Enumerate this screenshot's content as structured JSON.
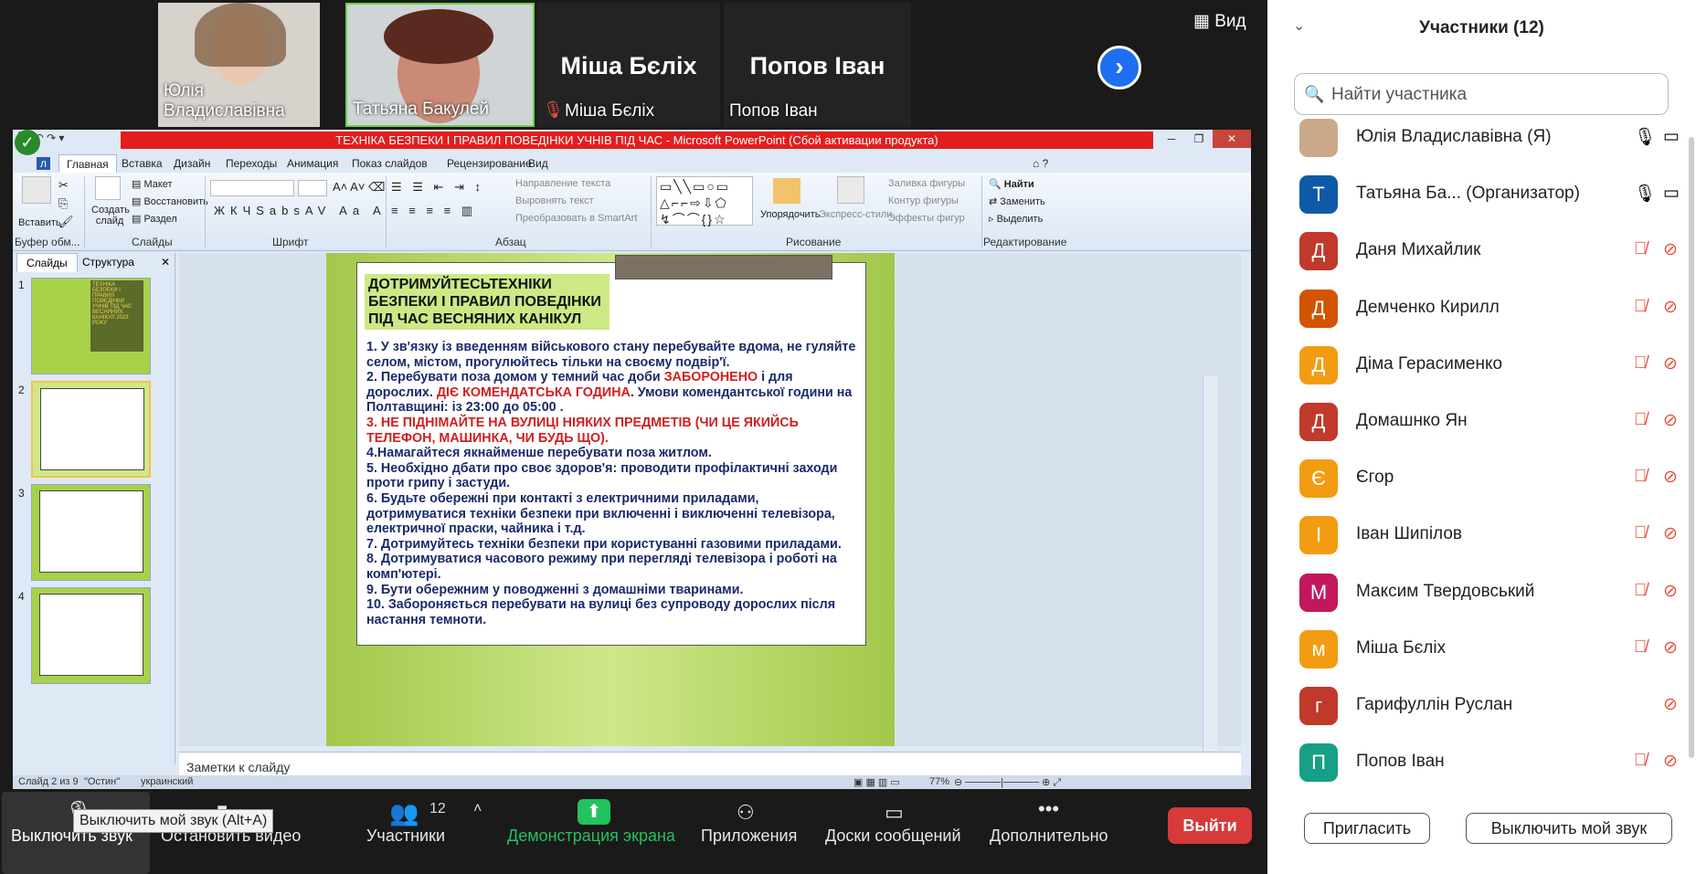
{
  "strip": {
    "tiles": [
      {
        "name": "Юлія Владиславівна"
      },
      {
        "name": "Татьяна Бакулей"
      },
      {
        "name": "Міша Бєліх",
        "big": "Міша Бєліх"
      },
      {
        "name": "Попов Іван",
        "big": "Попов Іван"
      }
    ],
    "view_label": "Вид"
  },
  "ppt": {
    "title": "ТЕХНІКА БЕЗПЕКИ І ПРАВИЛ ПОВЕДІНКИ УЧНІВ ПІД ЧАС  - Microsoft PowerPoint (Сбой активации продукта)",
    "file_tab": "л",
    "tabs": [
      "Главная",
      "Вставка",
      "Дизайн",
      "Переходы",
      "Анимация",
      "Показ слайдов",
      "Рецензирование",
      "Вид"
    ],
    "ribbon": {
      "paste": "Вставить",
      "clipboard_group": "Буфер обм...",
      "create_slide": "Создать слайд",
      "layout": "Макет",
      "restore": "Восстановить",
      "section": "Раздел",
      "slides_group": "Слайды",
      "font_group": "Шрифт",
      "paragraph_group": "Абзац",
      "text_direction": "Направление текста",
      "align_text": "Выровнять текст",
      "smartart": "Преобразовать в SmartArt",
      "arrange": "Упорядочить",
      "quick_styles": "Экспресс-стили",
      "shape_fill": "Заливка фигуры",
      "shape_outline": "Контур фигуры",
      "shape_effects": "Эффекты фигур",
      "drawing_group": "Рисование",
      "find": "Найти",
      "replace": "Заменить",
      "select": "Выделить",
      "editing_group": "Редактирование"
    },
    "left_tabs": {
      "slides": "Слайды",
      "outline": "Структура"
    },
    "slide_numbers": [
      "1",
      "2",
      "3",
      "4"
    ],
    "thumb1_text": "ТЕХНІКА БЕЗПЕКИ І ПРАВИЛ ПОВЕДІНКИ УЧНІВ ПІД ЧАС ВЕСНЯНИХ КАНІКУЛ 2023 РОКУ",
    "slide": {
      "title": "ДОТРИМУЙТЕСЬТЕХНІКИ БЕЗПЕКИ І ПРАВИЛ ПОВЕДІНКИ ПІД ЧАС ВЕСНЯНИХ КАНІКУЛ",
      "p1": "1. У зв'язку із введенням військового стану перебувайте вдома, не гуляйте селом, містом, прогулюйтесь тільки на своєму подвір'ї.",
      "p2a": "2. Перебувати  поза домом у темний час доби ",
      "p2b": "ЗАБОРОНЕНО",
      "p2c": " і для дорослих. ",
      "p2d": "ДІЄ КОМЕНДАТСЬКА ГОДИНА",
      "p2e": ". Умови комендантської години на Полтавщині: із 23:00 до 05:00 .",
      "p3": "3. НЕ ПІДНІМАЙТЕ НА ВУЛИЦІ НІЯКИХ ПРЕДМЕТІВ (ЧИ ЦЕ ЯКИЙСЬ ТЕЛЕФОН, МАШИНКА, ЧИ БУДЬ ЩО).",
      "p4": "4.Намагайтеся якнайменше перебувати поза житлом.",
      "p5": "5. Необхідно дбати про своє здоров'я: проводити профілактичні заходи проти грипу і застуди.",
      "p6": "6. Будьте обережні при контакті з електричними приладами, дотримуватися техніки безпеки при включенні і виключенні телевізора, електричної праски, чайника і т.д.",
      "p7": "7. Дотримуйтесь  техніки безпеки при користуванні газовими приладами.",
      "p8": "8. Дотримуватися часового режиму при перегляді телевізора і роботі на комп'ютері.",
      "p9": "9. Бути обережним у поводженні з домашніми тваринами.",
      "p10": "10. Забороняється перебувати на вулиці без супроводу дорослих після настання темноти."
    },
    "notes_placeholder": "Заметки к слайду",
    "status": {
      "slide_of": "Слайд 2 из 9",
      "theme": "\"Остин\"",
      "language": "украинский",
      "zoom": "77%"
    }
  },
  "toolbar": {
    "mute": "Выключить звук",
    "mute_tooltip": "Выключить мой звук (Alt+A)",
    "stop_video": "Остановить видео",
    "participants": "Участники",
    "participants_count": "12",
    "share": "Демонстрация экрана",
    "apps": "Приложения",
    "whiteboards": "Доски сообщений",
    "more": "Дополнительно",
    "leave": "Выйти"
  },
  "panel": {
    "title": "Участники (12)",
    "search_placeholder": "Найти участника",
    "participants": [
      {
        "initial": "",
        "name": "Юлія Владиславівна (Я)",
        "color": "#c9a98a",
        "muted": false
      },
      {
        "initial": "Т",
        "name": "Татьяна Ба...  (Организатор)",
        "color": "#0e5aa7",
        "muted": false
      },
      {
        "initial": "Д",
        "name": "Даня Михайлик",
        "color": "#c0392b",
        "muted": true
      },
      {
        "initial": "Д",
        "name": "Демченко Кирилл",
        "color": "#d35400",
        "muted": true
      },
      {
        "initial": "Д",
        "name": "Діма Герасименко",
        "color": "#f39c12",
        "muted": true
      },
      {
        "initial": "Д",
        "name": "Домашнко Ян",
        "color": "#c0392b",
        "muted": true
      },
      {
        "initial": "Є",
        "name": "Єгор",
        "color": "#f39c12",
        "muted": true
      },
      {
        "initial": "І",
        "name": "Іван Шипілов",
        "color": "#f39c12",
        "muted": true
      },
      {
        "initial": "М",
        "name": "Максим Твердовський",
        "color": "#c2185b",
        "muted": true
      },
      {
        "initial": "м",
        "name": "Міша Бєліх",
        "color": "#f39c12",
        "muted": true
      },
      {
        "initial": "г",
        "name": "Гарифуллін Руслан",
        "color": "#c0392b",
        "muted": true
      },
      {
        "initial": "П",
        "name": "Попов Іван",
        "color": "#16a085",
        "muted": true
      }
    ],
    "invite": "Пригласить",
    "mute_me": "Выключить мой звук"
  }
}
